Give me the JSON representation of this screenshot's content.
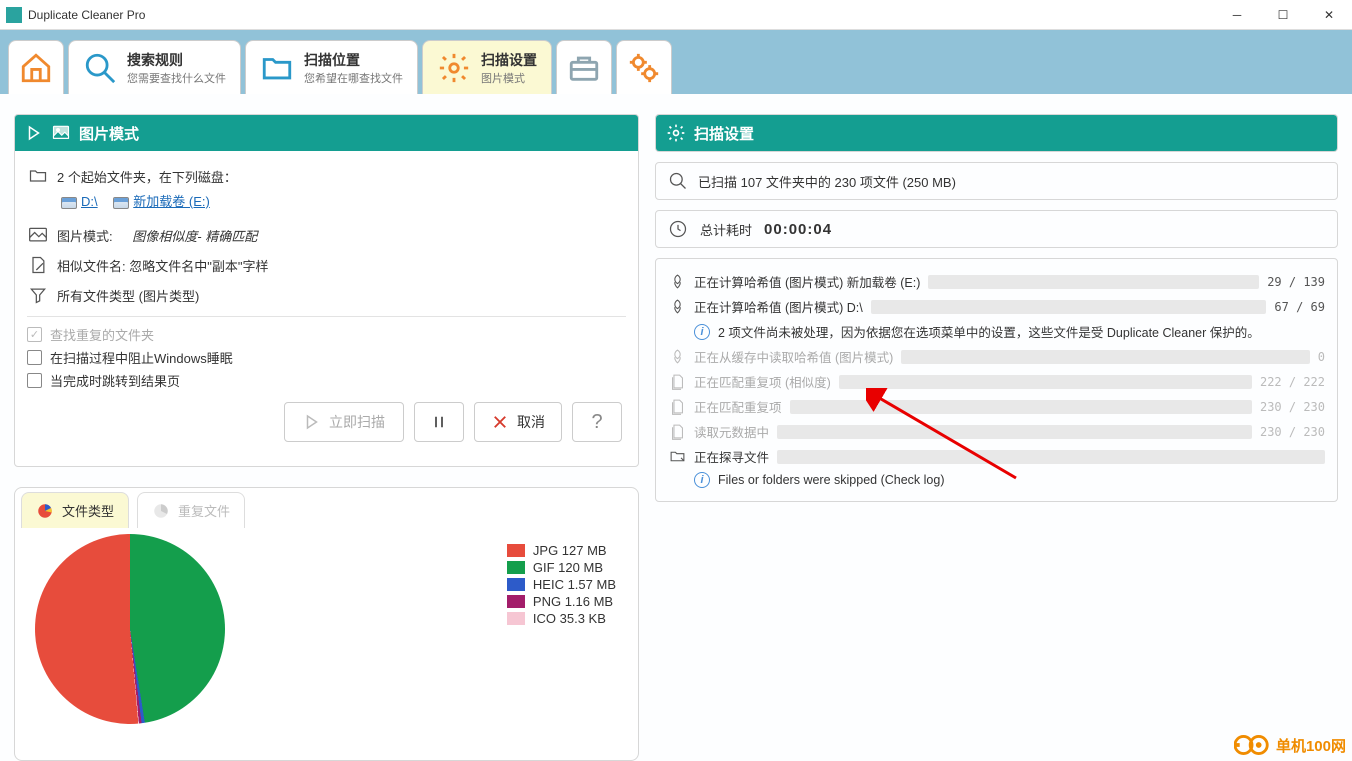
{
  "window": {
    "title": "Duplicate Cleaner Pro"
  },
  "tabs": {
    "search_rules": {
      "title": "搜索规则",
      "sub": "您需要查找什么文件"
    },
    "scan_location": {
      "title": "扫描位置",
      "sub": "您希望在哪查找文件"
    },
    "scan_settings": {
      "title": "扫描设置",
      "sub": "图片模式"
    }
  },
  "left": {
    "header": "图片模式",
    "folders_intro": "2 个起始文件夹，在下列磁盘：",
    "drive1": "D:\\",
    "drive2": "新加载卷 (E:)",
    "image_mode_label": "图片模式:",
    "image_mode_value": "图像相似度- 精确匹配",
    "similar_name": "相似文件名: 忽略文件名中\"副本\"字样",
    "file_types": "所有文件类型 (图片类型)",
    "check1": "查找重复的文件夹",
    "check2": "在扫描过程中阻止Windows睡眠",
    "check3": "当完成时跳转到结果页",
    "btn_scan": "立即扫描",
    "btn_cancel": "取消"
  },
  "right": {
    "header": "扫描设置",
    "summary": "已扫描 107 文件夹中的 230 项文件 (250 MB)",
    "timer_label": "总计耗时",
    "timer_value": "00:00:04",
    "progress": [
      {
        "label": "正在计算哈希值 (图片模式) 新加载卷 (E:)",
        "pct": 21,
        "count": "29 / 139",
        "dim": false,
        "icon": "hash"
      },
      {
        "label": "正在计算哈希值 (图片模式) D:\\",
        "pct": 97,
        "count": "67 / 69",
        "dim": false,
        "icon": "hash"
      }
    ],
    "note": "2 项文件尚未被处理，因为依据您在选项菜单中的设置，这些文件是受 Duplicate Cleaner 保护的。",
    "progress2": [
      {
        "label": "正在从缓存中读取哈希值 (图片模式)",
        "pct": 100,
        "count": "0",
        "dim": true,
        "icon": "hash"
      },
      {
        "label": "正在匹配重复项 (相似度)",
        "pct": 100,
        "count": "222 / 222",
        "dim": true,
        "icon": "doc"
      },
      {
        "label": "正在匹配重复项",
        "pct": 100,
        "count": "230 / 230",
        "dim": true,
        "icon": "doc"
      },
      {
        "label": "读取元数据中",
        "pct": 100,
        "count": "230 / 230",
        "dim": true,
        "icon": "doc"
      }
    ],
    "searching": {
      "label": "正在探寻文件",
      "pct": 100,
      "dim": false,
      "icon": "folder"
    },
    "skip_note": "Files or folders were skipped (Check log)"
  },
  "chart_tabs": {
    "types": "文件类型",
    "dupes": "重复文件"
  },
  "chart_data": {
    "type": "pie",
    "title": "",
    "series": [
      {
        "name": "JPG",
        "label": "JPG 127 MB",
        "value": 127,
        "unit": "MB",
        "color": "#e74c3c"
      },
      {
        "name": "GIF",
        "label": "GIF 120 MB",
        "value": 120,
        "unit": "MB",
        "color": "#149e4c"
      },
      {
        "name": "HEIC",
        "label": "HEIC 1.57 MB",
        "value": 1.57,
        "unit": "MB",
        "color": "#2d5bc9"
      },
      {
        "name": "PNG",
        "label": "PNG 1.16 MB",
        "value": 1.16,
        "unit": "MB",
        "color": "#a31d6a"
      },
      {
        "name": "ICO",
        "label": "ICO 35.3 KB",
        "value": 0.0345,
        "unit": "MB",
        "color": "#f6c6d3"
      }
    ]
  },
  "watermark": "单机100网"
}
